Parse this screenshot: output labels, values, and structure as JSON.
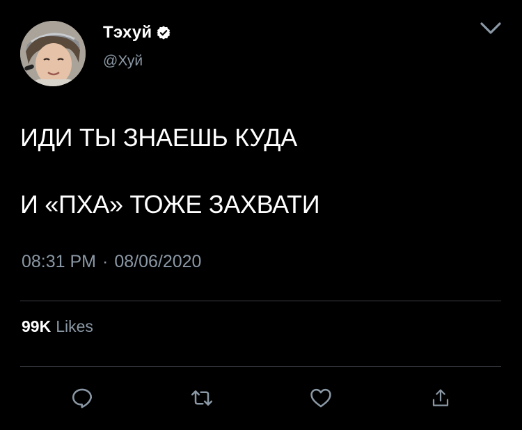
{
  "author": {
    "display_name": "Тэхуй",
    "handle": "@Хуй",
    "verified": true
  },
  "tweet": {
    "lines": [
      "ИДИ ТЫ ЗНАЕШЬ КУДА",
      "И «ПХА» ТОЖЕ ЗАХВАТИ"
    ],
    "time": "08:31 PM",
    "separator": "·",
    "date": "08/06/2020"
  },
  "stats": {
    "likes_count": "99K",
    "likes_label": "Likes"
  },
  "icons": {
    "verified": "verified-badge-icon",
    "menu": "chevron-down-icon",
    "reply": "reply-icon",
    "retweet": "retweet-icon",
    "like": "heart-icon",
    "share": "share-icon"
  },
  "colors": {
    "background": "#000000",
    "text": "#ffffff",
    "muted": "#8b98a5",
    "divider": "#3a3f45",
    "icon": "#8b98a5"
  }
}
